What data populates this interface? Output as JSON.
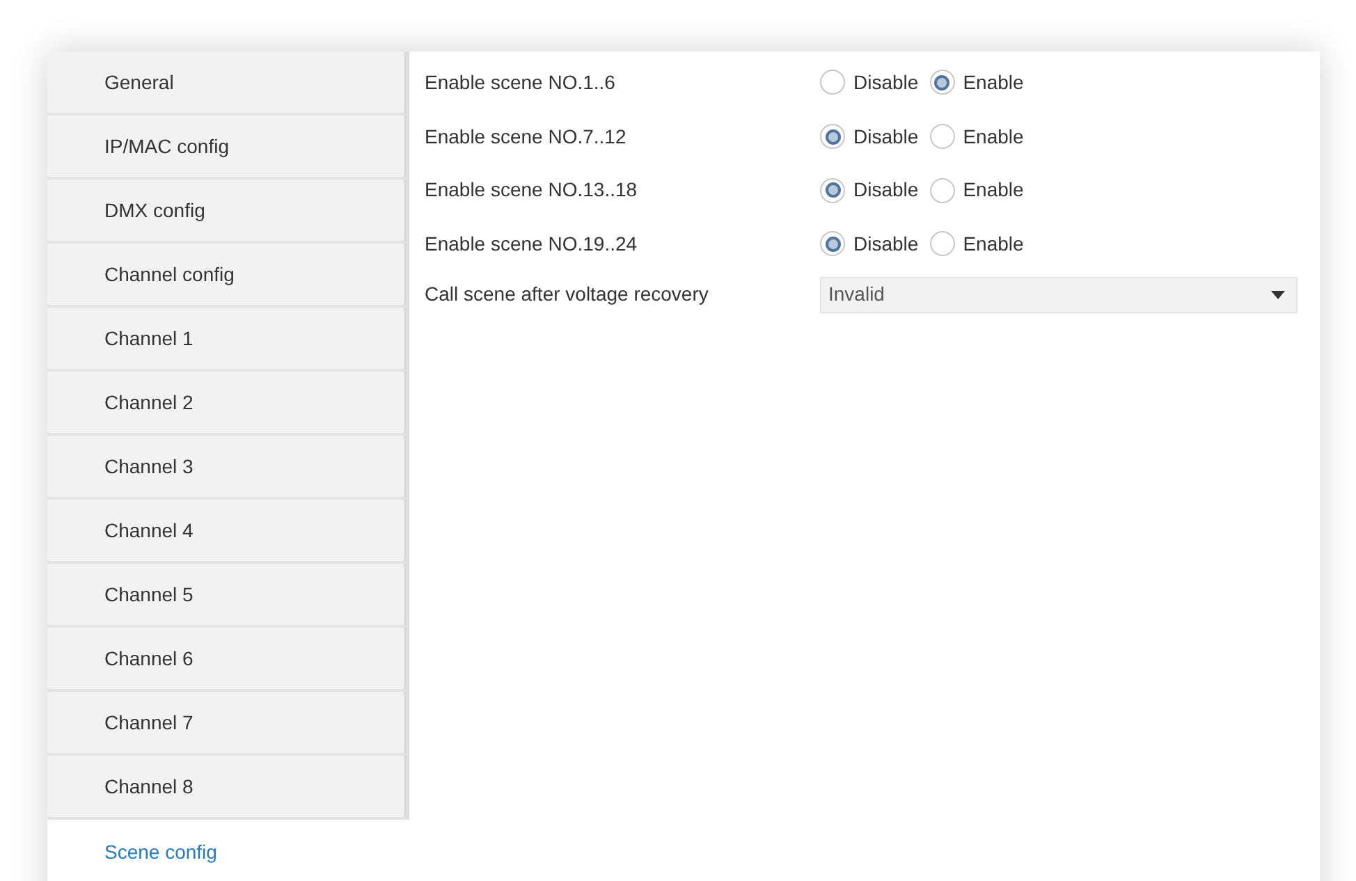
{
  "sidebar": {
    "items": [
      {
        "label": "General",
        "selected": false
      },
      {
        "label": "IP/MAC config",
        "selected": false
      },
      {
        "label": "DMX config",
        "selected": false
      },
      {
        "label": "Channel config",
        "selected": false
      },
      {
        "label": "Channel 1",
        "selected": false
      },
      {
        "label": "Channel 2",
        "selected": false
      },
      {
        "label": "Channel 3",
        "selected": false
      },
      {
        "label": "Channel 4",
        "selected": false
      },
      {
        "label": "Channel 5",
        "selected": false
      },
      {
        "label": "Channel 6",
        "selected": false
      },
      {
        "label": "Channel 7",
        "selected": false
      },
      {
        "label": "Channel 8",
        "selected": false
      },
      {
        "label": "Scene config",
        "selected": true
      }
    ]
  },
  "settings": [
    {
      "kind": "radio",
      "label": "Enable scene NO.1..6",
      "options": [
        {
          "label": "Disable",
          "selected": false
        },
        {
          "label": "Enable",
          "selected": true
        }
      ]
    },
    {
      "kind": "radio",
      "label": "Enable scene NO.7..12",
      "options": [
        {
          "label": "Disable",
          "selected": true
        },
        {
          "label": "Enable",
          "selected": false
        }
      ]
    },
    {
      "kind": "radio",
      "label": "Enable scene NO.13..18",
      "options": [
        {
          "label": "Disable",
          "selected": true
        },
        {
          "label": "Enable",
          "selected": false
        }
      ]
    },
    {
      "kind": "radio",
      "label": "Enable scene NO.19..24",
      "options": [
        {
          "label": "Disable",
          "selected": true
        },
        {
          "label": "Enable",
          "selected": false
        }
      ]
    },
    {
      "kind": "dropdown",
      "label": "Call scene after voltage recovery",
      "value": "Invalid"
    }
  ]
}
